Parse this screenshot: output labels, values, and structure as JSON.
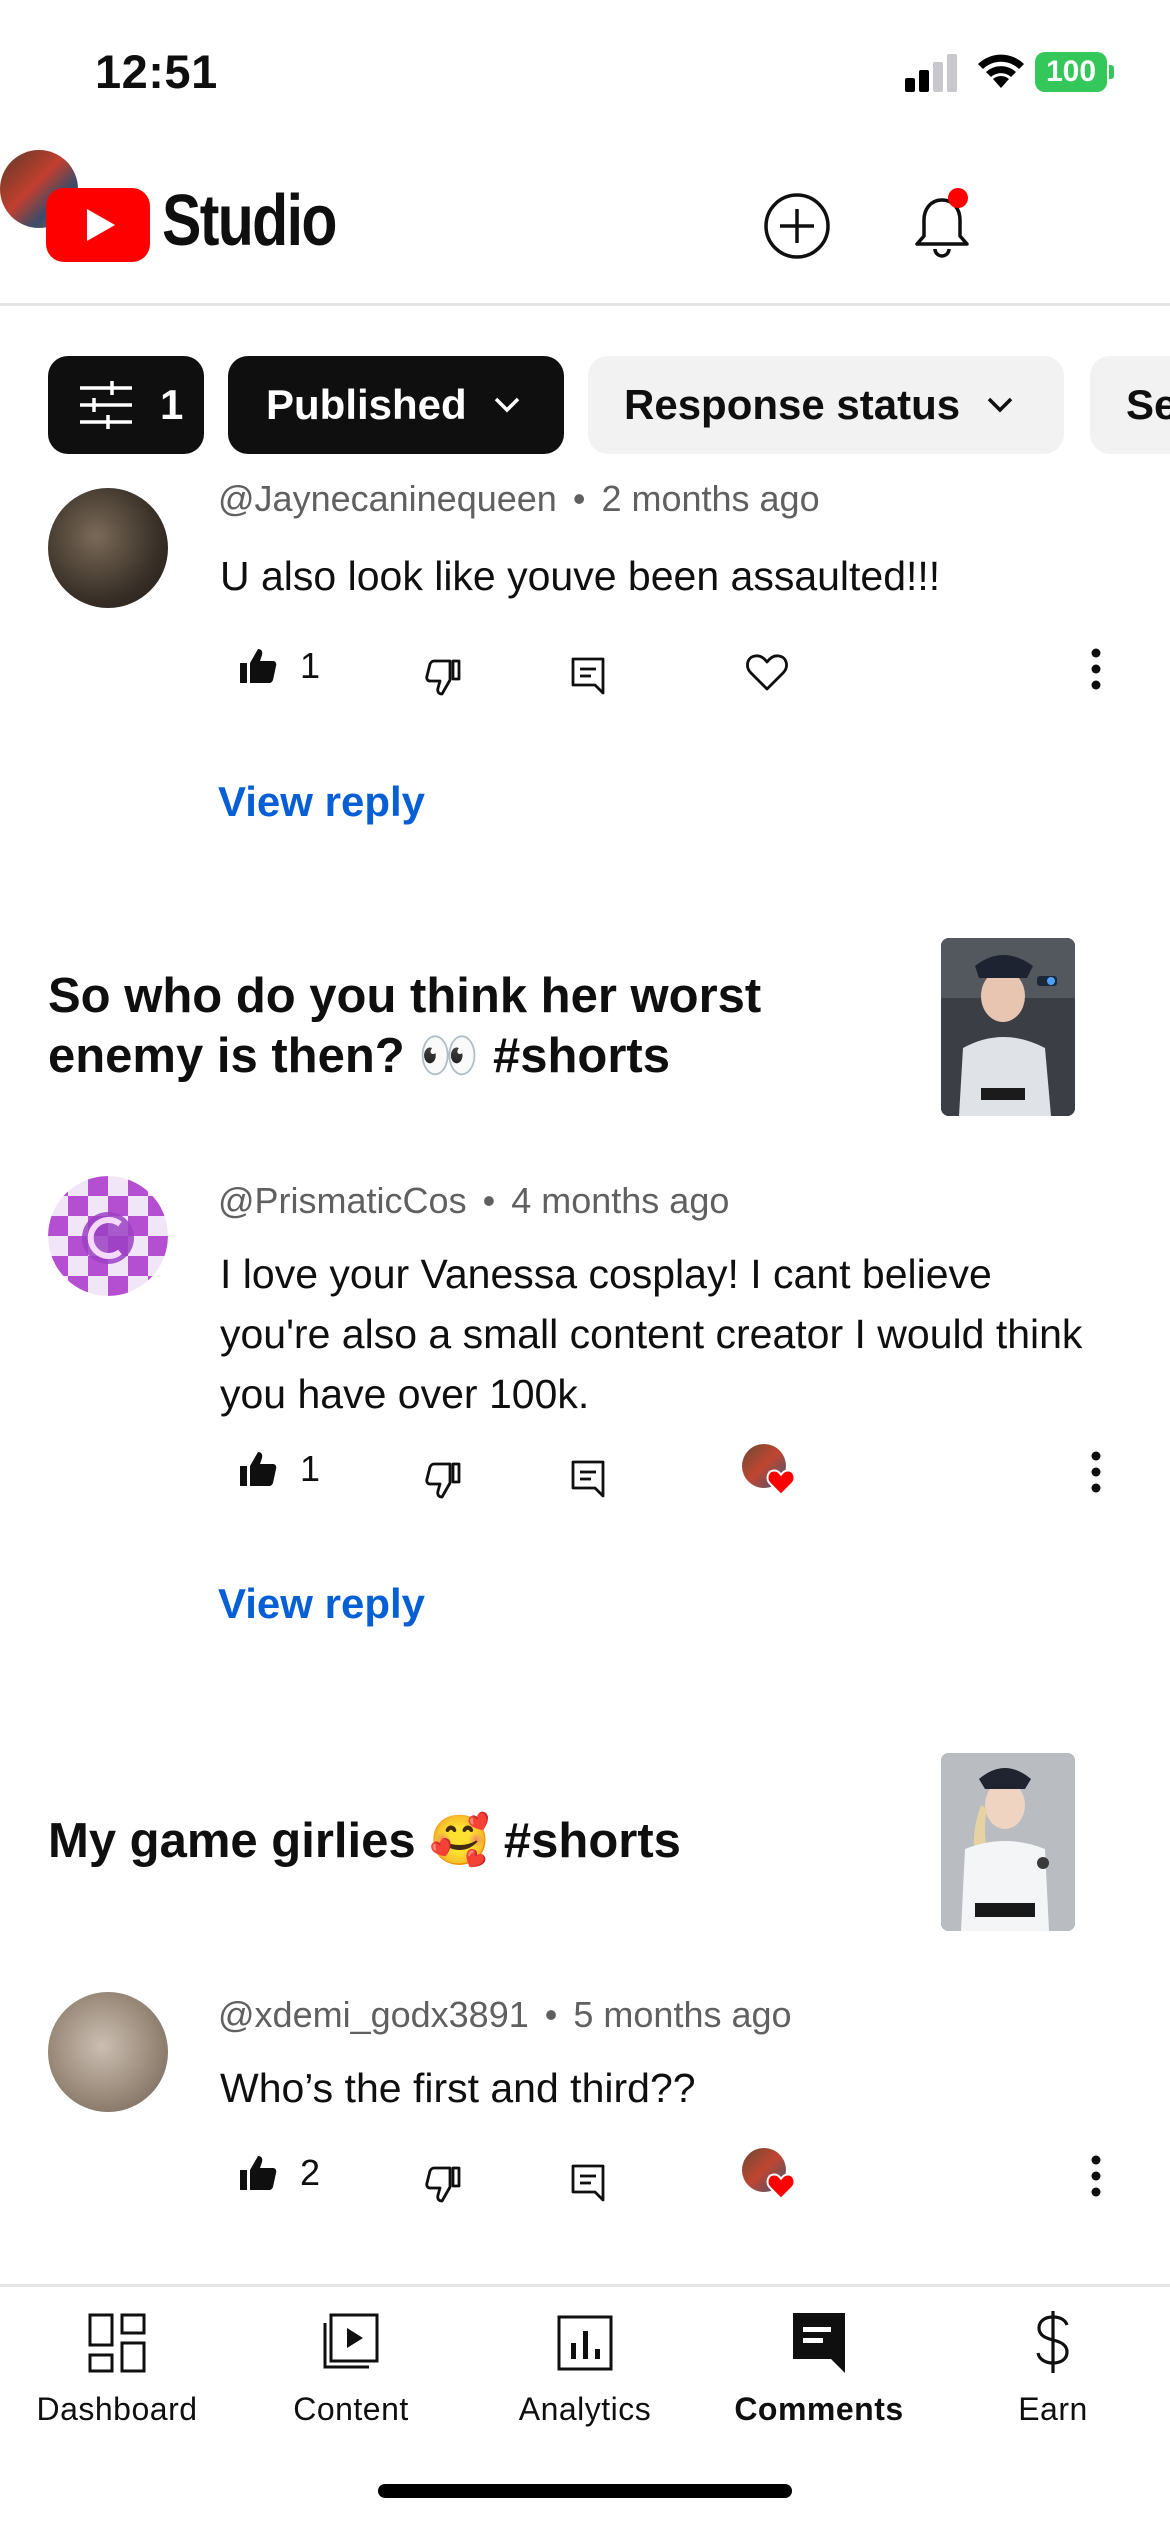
{
  "status_bar": {
    "time": "12:51",
    "battery": "100"
  },
  "header": {
    "app_name": "Studio"
  },
  "filters": {
    "filter_count": "1",
    "published": "Published",
    "response_status": "Response status",
    "sort_partial": "Se"
  },
  "comments": [
    {
      "handle": "@Jaynecaninequeen",
      "age": "2 months ago",
      "text": "U also look like youve been assaulted!!!",
      "likes": "1",
      "view_reply": "View reply"
    },
    {
      "handle": "@PrismaticCos",
      "age": "4 months ago",
      "text": "I love your Vanessa cosplay! I cant believe you're also a small content creator I  would think you have over 100k.",
      "likes": "1",
      "view_reply": "View reply"
    },
    {
      "handle": "@xdemi_godx3891",
      "age": "5 months ago",
      "text": "Who’s the first and third??",
      "likes": "2"
    }
  ],
  "meta_separator": "•",
  "videos": [
    {
      "title": "So who do you think her worst enemy is then? 👀 #shorts"
    },
    {
      "title": "My game girlies 🥰 #shorts"
    }
  ],
  "nav": {
    "dashboard": "Dashboard",
    "content": "Content",
    "analytics": "Analytics",
    "comments": "Comments",
    "earn": "Earn"
  },
  "colors": {
    "brand_red": "#ff0000",
    "link_blue": "#065fd4",
    "battery_green": "#34c759",
    "chip_dark": "#0f0f0f",
    "chip_light": "#f2f2f2"
  }
}
